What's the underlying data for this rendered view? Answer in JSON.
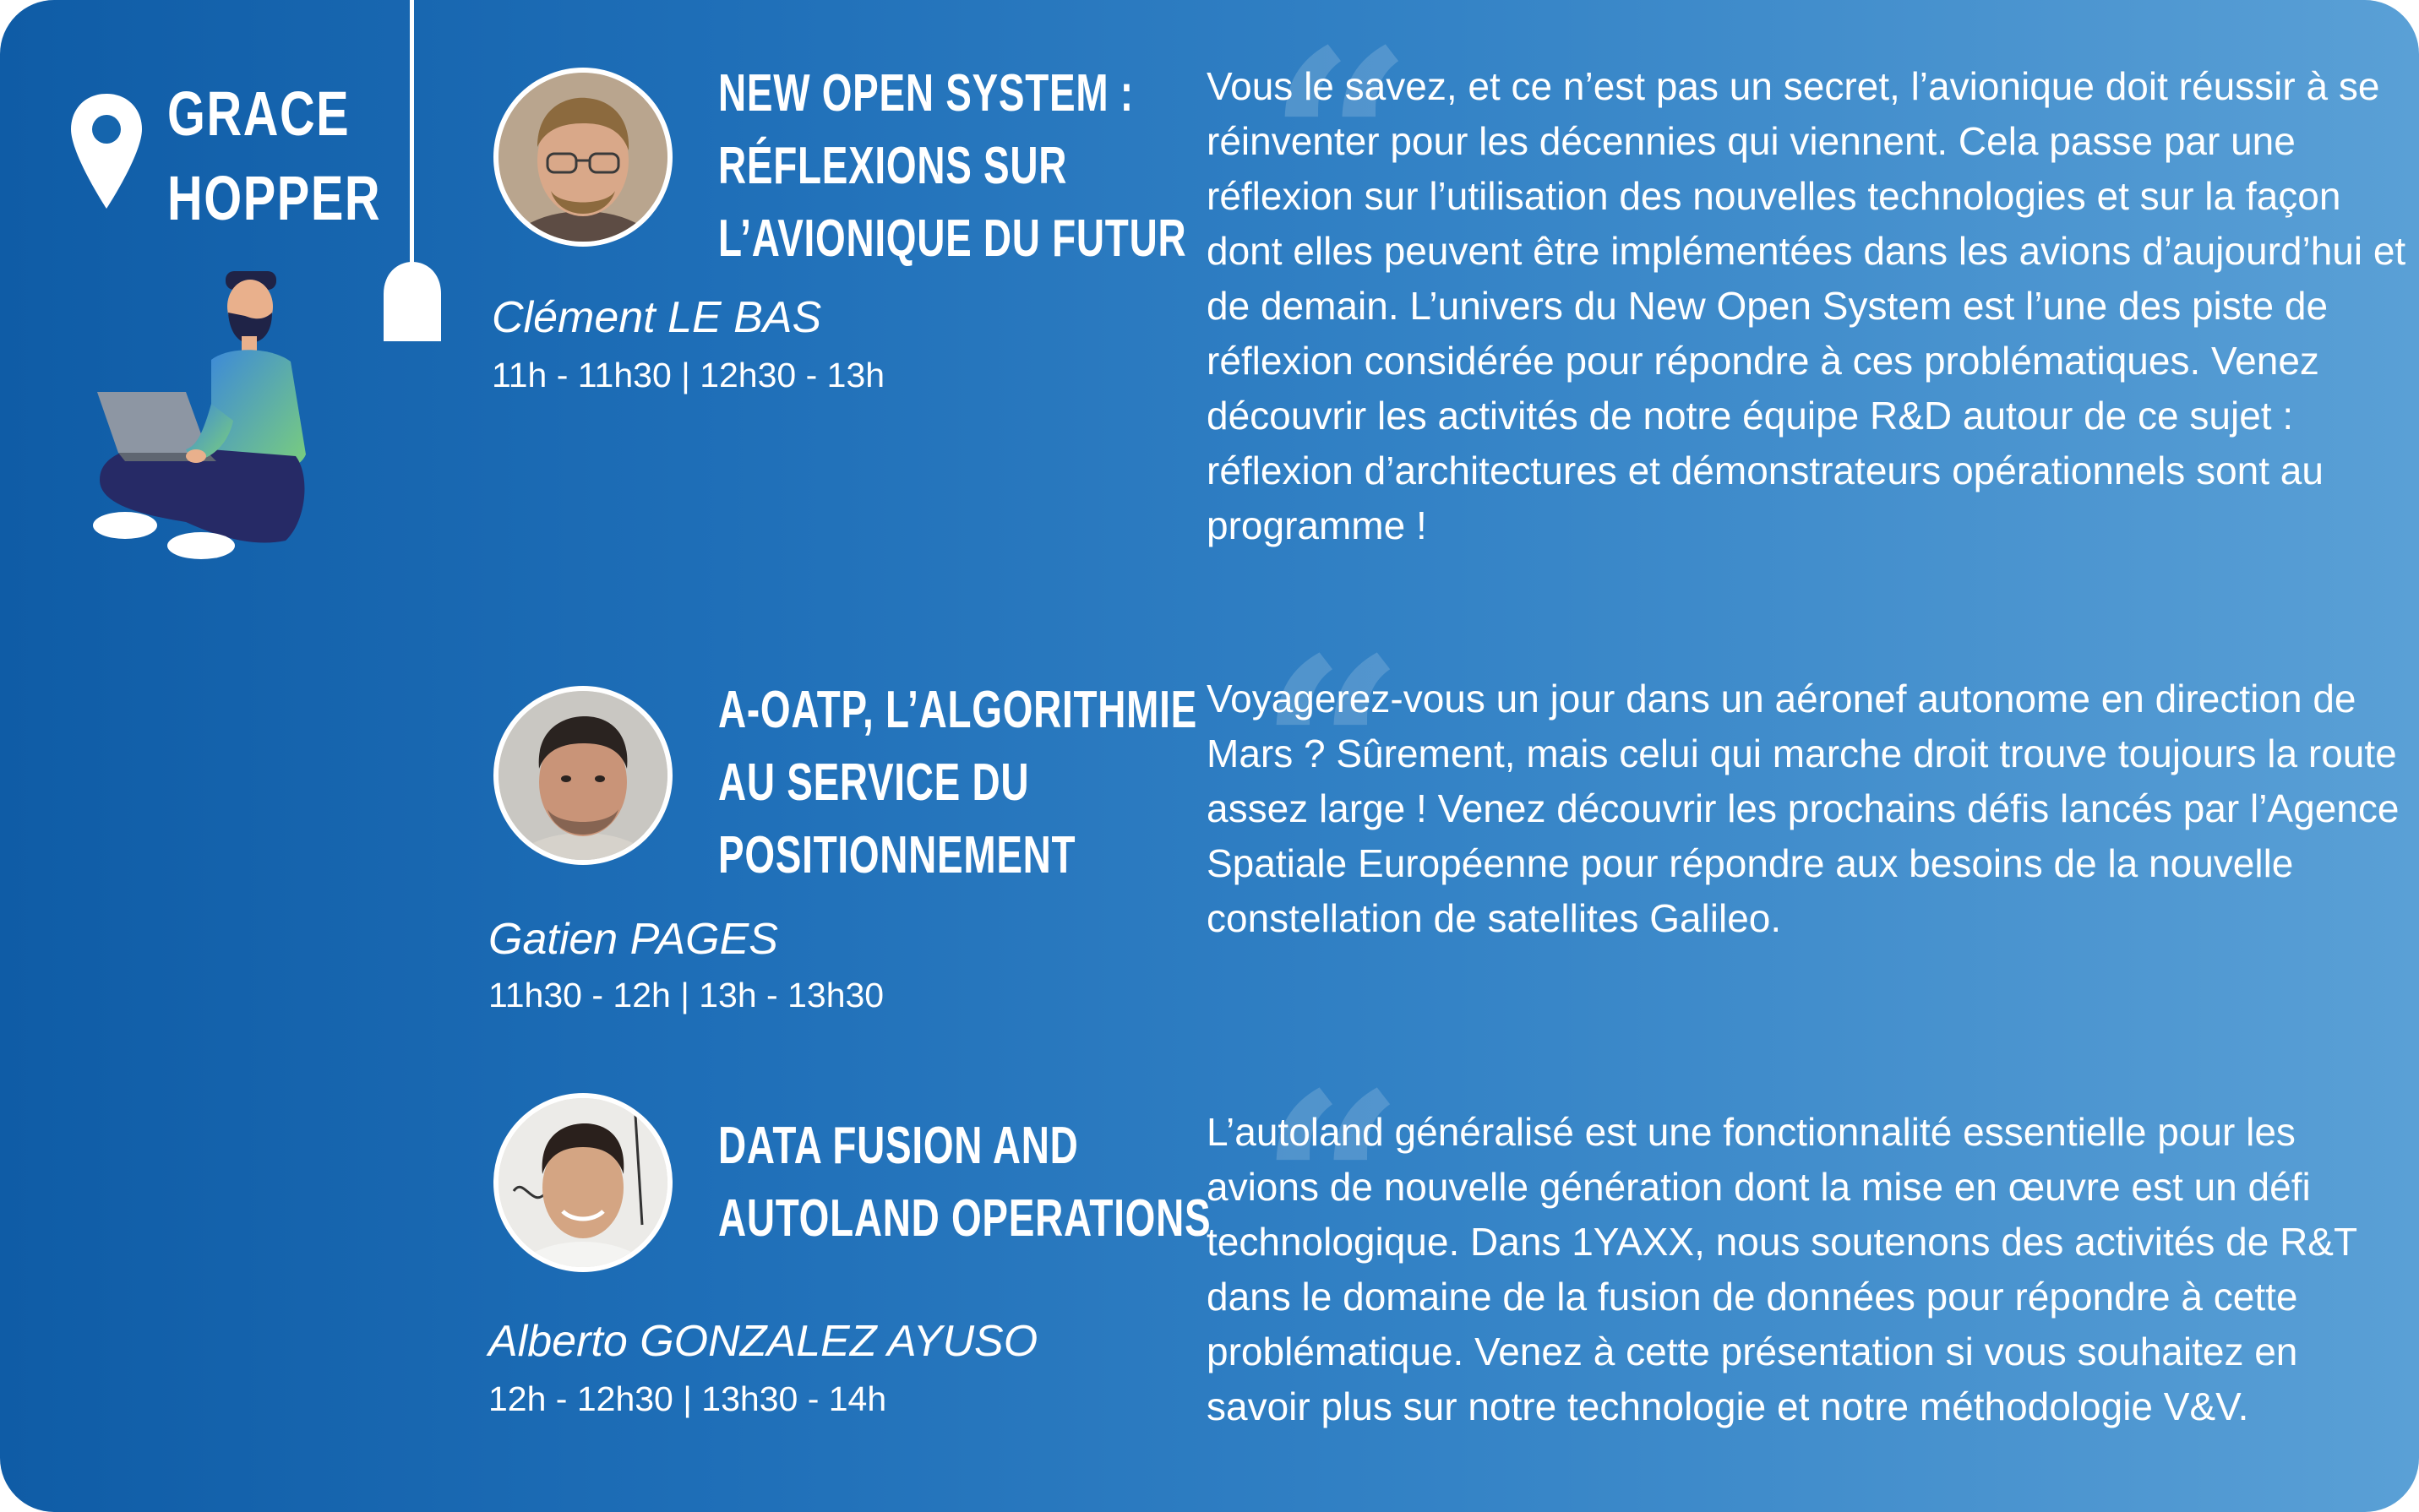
{
  "room": {
    "name_line1": "GRACE",
    "name_line2": "HOPPER"
  },
  "quote_glyph": "“",
  "talks": [
    {
      "title_lines": [
        "NEW OPEN SYSTEM :",
        "RÉFLEXIONS SUR",
        "L’AVIONIQUE DU FUTUR"
      ],
      "speaker": "Clément LE BAS",
      "times": "11h - 11h30  |  12h30 - 13h",
      "description": "Vous le savez, et ce n’est pas un secret,  l’avionique doit réussir à se réinventer pour les décennies qui viennent. Cela passe par une réflexion sur l’utilisation des nouvelles technologies et sur la façon dont elles peuvent être implémentées dans les avions d’aujourd’hui et de demain. L’univers du New Open System est l’une des piste de réflexion considérée pour répondre à ces problématiques. Venez découvrir les activités de notre équipe R&D autour de ce sujet : réflexion d’architectures et démonstrateurs opérationnels sont au programme !"
    },
    {
      "title_lines": [
        "A-OATP, L’ALGORITHMIE",
        "AU SERVICE DU",
        "POSITIONNEMENT"
      ],
      "speaker": "Gatien PAGES",
      "times": "11h30 - 12h  |  13h - 13h30",
      "description": "Voyagerez-vous un jour dans un aéronef autonome en direction de Mars ? Sûrement, mais celui qui marche droit trouve toujours la route assez large ! Venez découvrir les prochains défis lancés par l’Agence Spatiale Européenne pour répondre aux besoins de la nouvelle constellation de satellites Galileo."
    },
    {
      "title_lines": [
        "DATA FUSION AND",
        "AUTOLAND OPERATIONS"
      ],
      "speaker": "Alberto GONZALEZ AYUSO",
      "times": "12h - 12h30  |  13h30 - 14h",
      "description": "L’autoland généralisé est une fonctionnalité essentielle pour les avions de nouvelle génération dont la mise en œuvre est un défi technologique. Dans 1YAXX, nous soutenons des activités de R&T dans le domaine de la fusion de données pour répondre à cette problématique. Venez à cette présentation si vous souhaitez en savoir plus sur notre technologie et notre méthodologie V&V."
    }
  ],
  "colors": {
    "gradient_start": "#0f5ca6",
    "gradient_end": "#5aa0d6",
    "text": "#ffffff",
    "figure_sweater_start": "#3d8ad8",
    "figure_sweater_end": "#7cd07a",
    "figure_pants": "#262a66"
  },
  "icons": [
    "location-pin-icon",
    "ceiling-lamp-icon",
    "laptop-person-illustration",
    "quote-mark-icon"
  ]
}
